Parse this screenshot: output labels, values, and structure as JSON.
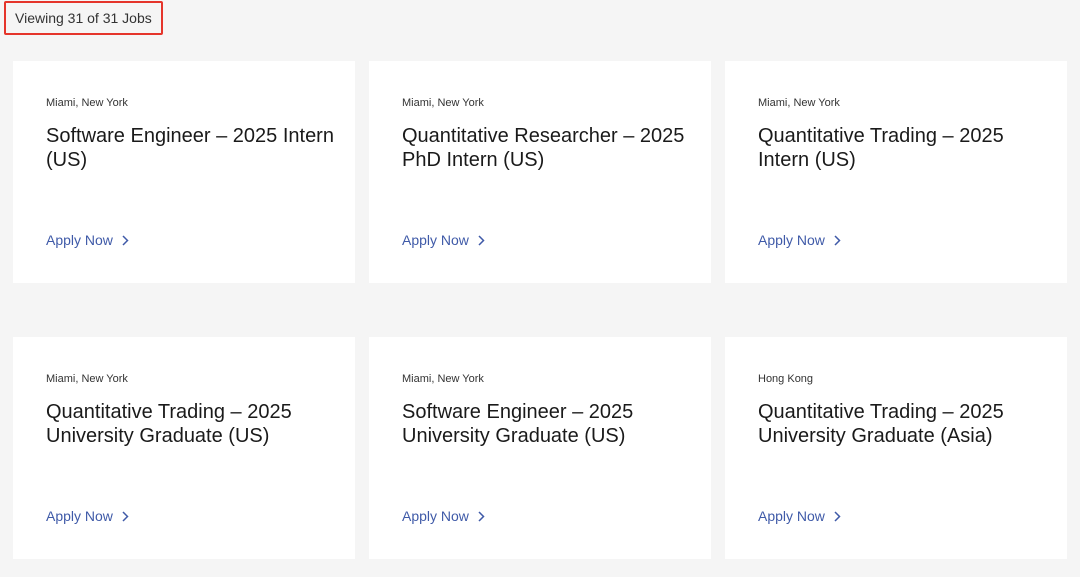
{
  "results": {
    "count_label": "Viewing 31 of 31 Jobs"
  },
  "jobs": [
    {
      "location": "Miami, New York",
      "title": "Software Engineer – 2025 Intern (US)",
      "cta": "Apply Now"
    },
    {
      "location": "Miami, New York",
      "title": "Quantitative Researcher – 2025 PhD Intern (US)",
      "cta": "Apply Now"
    },
    {
      "location": "Miami, New York",
      "title": "Quantitative Trading – 2025 Intern (US)",
      "cta": "Apply Now"
    },
    {
      "location": "Miami, New York",
      "title": "Quantitative Trading – 2025 University Graduate (US)",
      "cta": "Apply Now"
    },
    {
      "location": "Miami, New York",
      "title": "Software Engineer – 2025 University Graduate (US)",
      "cta": "Apply Now"
    },
    {
      "location": "Hong Kong",
      "title": "Quantitative Trading – 2025 University Graduate (Asia)",
      "cta": "Apply Now"
    }
  ],
  "icons": {
    "apply": "chevron-right-icon"
  },
  "colors": {
    "background": "#f5f5f5",
    "card": "#ffffff",
    "link": "#3f5aa8",
    "highlight_border": "#e5352b"
  }
}
